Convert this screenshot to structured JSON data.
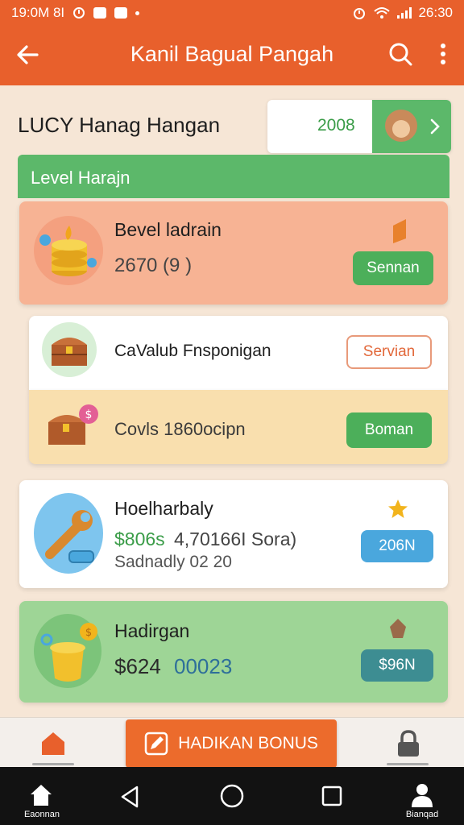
{
  "status_bar": {
    "time_left": "19:0M 8I",
    "time_right": "26:30"
  },
  "app_bar": {
    "title": "Kanil Bagual Pangah"
  },
  "user": {
    "name": "LUCY  Hanag Hangan",
    "score": "2008"
  },
  "level_section": {
    "header": "Level Harajn"
  },
  "cards": [
    {
      "title": "Bevel ladrain",
      "subtitle": "2670 (9 )",
      "button": "Sennan",
      "icon": "coin-stack-icon",
      "corner_icon": "bookmark-icon"
    },
    {
      "title": "CaValub Fnsponigan",
      "button": "Servian",
      "icon": "treasure-chest-icon"
    },
    {
      "title": "Covls 1860ocipn",
      "button": "Boman",
      "icon": "treasure-chest-coin-icon"
    },
    {
      "title": "Hoelharbaly",
      "price": "$806s",
      "detail": "4,70166I Sora)",
      "date": "Sadnadly 02 20",
      "button": "206N",
      "icon": "wrench-icon",
      "corner_icon": "star-icon"
    },
    {
      "title": "Hadirgan",
      "price": "$624",
      "detail": "00023",
      "button": "$96N",
      "icon": "gold-pot-icon",
      "corner_icon": "leaf-icon"
    }
  ],
  "bottom_bar": {
    "bonus_label": "HADIKAN BONUS"
  },
  "nav_bar": {
    "left_label": "Eaonnan",
    "right_label": "Bianqad"
  },
  "colors": {
    "primary": "#e8602c",
    "green": "#5cb86a",
    "blue": "#4aa7dd",
    "teal": "#3d8d92"
  }
}
